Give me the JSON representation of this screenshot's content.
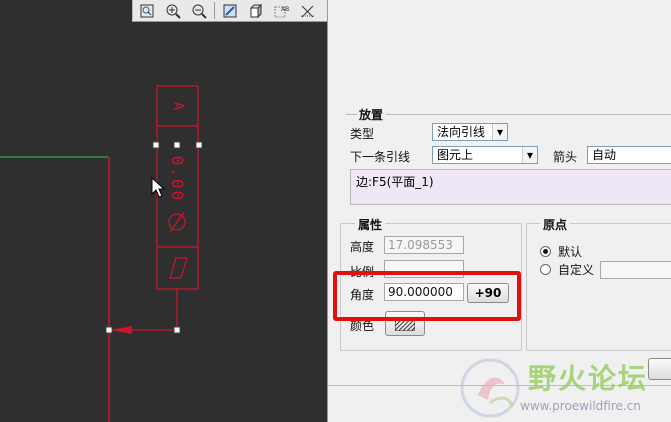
{
  "toolbar": {
    "icons": [
      "zoom-fit-icon",
      "zoom-in-icon",
      "zoom-out-icon",
      "repaint-icon",
      "shading-icon",
      "annotation-display-icon",
      "datum-display-icon"
    ]
  },
  "canvas": {
    "gtol_letter": "A",
    "gtol_value": "0.00"
  },
  "panel": {
    "placement": {
      "title": "放置",
      "type_label": "类型",
      "type_value": "法向引线",
      "next_leader_label": "下一条引线",
      "next_leader_value": "图元上",
      "arrow_label": "箭头",
      "arrow_value": "自动",
      "reference_text": "边:F5(平面_1)"
    },
    "properties": {
      "title": "属性",
      "height_label": "高度",
      "height_value": "17.098553",
      "ratio_label": "比例",
      "angle_label": "角度",
      "angle_value": "90.000000",
      "rotate_button": "+90",
      "color_label": "颜色"
    },
    "origin": {
      "title": "原点",
      "default_label": "默认",
      "custom_label": "自定义"
    }
  },
  "watermark": {
    "title": "野火论坛",
    "url": "www.proewildfire.cn"
  },
  "colors": {
    "annotation": "#d0142c",
    "geometry": "#3fbf4a",
    "highlight": "#e01010"
  }
}
